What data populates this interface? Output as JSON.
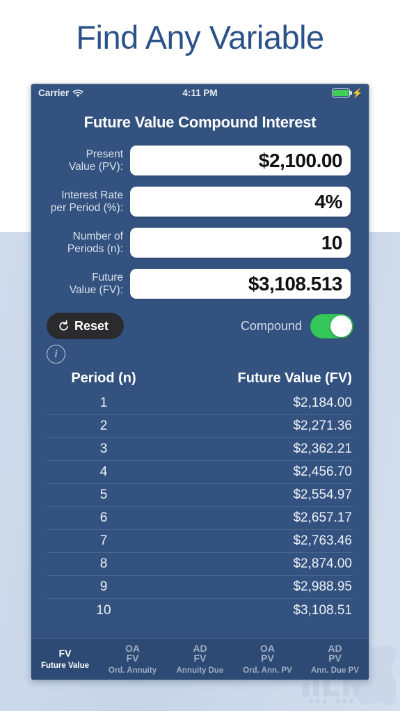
{
  "page": {
    "headline": "Find Any Variable",
    "bg_top_color": "#ffffff",
    "bg_bottom_color": "#ccd9e8"
  },
  "status_bar": {
    "carrier": "Carrier",
    "wifi_icon": "wifi-icon",
    "time": "4:11 PM",
    "battery_icon": "battery-icon",
    "battery_color": "#3fd157",
    "charging_icon": "lightning-bolt-icon"
  },
  "screen": {
    "title": "Future Value Compound Interest",
    "background_color": "#33527f"
  },
  "form": {
    "fields": [
      {
        "label_line1": "Present",
        "label_line2": "Value (PV):",
        "value": "$2,100.00"
      },
      {
        "label_line1": "Interest Rate",
        "label_line2": "per Period (%):",
        "value": "4%"
      },
      {
        "label_line1": "Number of",
        "label_line2": "Periods (n):",
        "value": "10"
      },
      {
        "label_line1": "Future",
        "label_line2": "Value (FV):",
        "value": "$3,108.513"
      }
    ]
  },
  "actions": {
    "reset_label": "Reset",
    "reset_icon": "rotate-counterclockwise-icon",
    "compound_label": "Compound",
    "compound_on": true,
    "toggle_on_color": "#34c759",
    "info_icon": "info-circle-icon"
  },
  "table": {
    "headers": [
      "Period (n)",
      "Future Value (FV)"
    ],
    "rows": [
      {
        "period": "1",
        "fv": "$2,184.00"
      },
      {
        "period": "2",
        "fv": "$2,271.36"
      },
      {
        "period": "3",
        "fv": "$2,362.21"
      },
      {
        "period": "4",
        "fv": "$2,456.70"
      },
      {
        "period": "5",
        "fv": "$2,554.97"
      },
      {
        "period": "6",
        "fv": "$2,657.17"
      },
      {
        "period": "7",
        "fv": "$2,763.46"
      },
      {
        "period": "8",
        "fv": "$2,874.00"
      },
      {
        "period": "9",
        "fv": "$2,988.95"
      },
      {
        "period": "10",
        "fv": "$3,108.51"
      }
    ]
  },
  "tabbar": {
    "tabs": [
      {
        "abbr_line1": "FV",
        "abbr_line2": "",
        "name": "Future Value",
        "active": true
      },
      {
        "abbr_line1": "OA",
        "abbr_line2": "FV",
        "name": "Ord. Annuity",
        "active": false
      },
      {
        "abbr_line1": "AD",
        "abbr_line2": "FV",
        "name": "Annuity Due",
        "active": false
      },
      {
        "abbr_line1": "OA",
        "abbr_line2": "PV",
        "name": "Ord. Ann. PV",
        "active": false
      },
      {
        "abbr_line1": "AD",
        "abbr_line2": "PV",
        "name": "Ann. Due PV",
        "active": false
      }
    ]
  }
}
